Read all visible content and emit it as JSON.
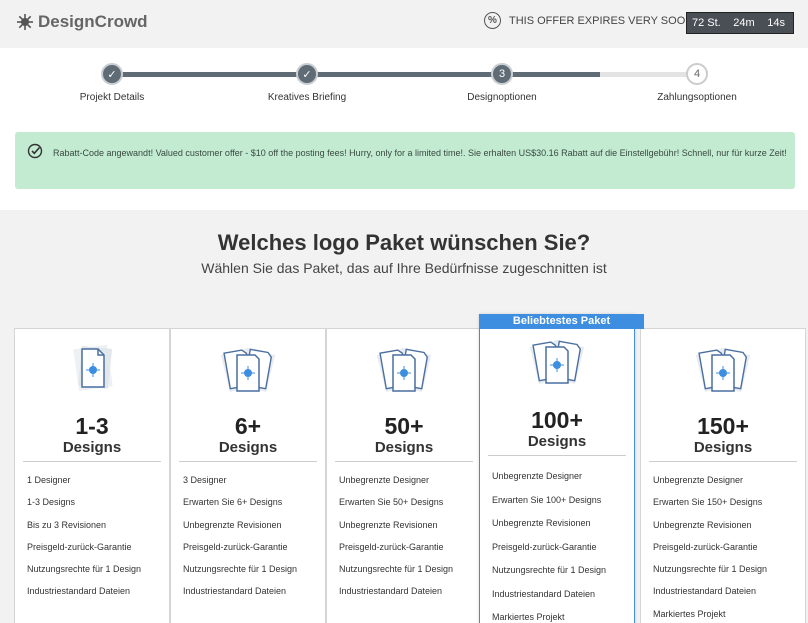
{
  "header": {
    "logo_text": "DesignCrowd",
    "offer_text": "THIS OFFER EXPIRES VERY SOON",
    "timer": {
      "hours": "72 St.",
      "minutes": "24m",
      "seconds": "14s"
    }
  },
  "steps": [
    {
      "label": "Projekt Details",
      "state": "done",
      "marker": "✓"
    },
    {
      "label": "Kreatives Briefing",
      "state": "done",
      "marker": "✓"
    },
    {
      "label": "Designoptionen",
      "state": "current",
      "marker": "3"
    },
    {
      "label": "Zahlungsoptionen",
      "state": "pending",
      "marker": "4"
    }
  ],
  "banner": {
    "text": "Rabatt-Code angewandt! Valued customer offer - $10 off the posting fees! Hurry, only for a limited time!. Sie erhalten US$30.16 Rabatt auf die Einstellgebühr! Schnell, nur für kurze Zeit!",
    "color": "#c2ebd2"
  },
  "main": {
    "title": "Welches logo Paket wünschen Sie?",
    "subtitle": "Wählen Sie das Paket, das auf Ihre Bedürfnisse zugeschnitten ist"
  },
  "packages": [
    {
      "number": "1-3",
      "word": "Designs",
      "icon": "single-design-icon",
      "features": [
        "1 Designer",
        "1-3 Designs",
        "Bis zu 3 Revisionen",
        "Preisgeld-zurück-Garantie",
        "Nutzungsrechte für 1 Design",
        "Industriestandard Dateien"
      ]
    },
    {
      "number": "6+",
      "word": "Designs",
      "icon": "multi-design-icon",
      "features": [
        "3 Designer",
        "Erwarten Sie 6+ Designs",
        "Unbegrenzte Revisionen",
        "Preisgeld-zurück-Garantie",
        "Nutzungsrechte für 1 Design",
        "Industriestandard Dateien"
      ]
    },
    {
      "number": "50+",
      "word": "Designs",
      "icon": "multi-design-icon",
      "features": [
        "Unbegrenzte Designer",
        "Erwarten Sie 50+ Designs",
        "Unbegrenzte Revisionen",
        "Preisgeld-zurück-Garantie",
        "Nutzungsrechte für 1 Design",
        "Industriestandard Dateien"
      ]
    },
    {
      "number": "100+",
      "word": "Designs",
      "icon": "multi-design-icon",
      "ribbon": "Beliebtestes Paket",
      "features": [
        "Unbegrenzte Designer",
        "Erwarten Sie 100+ Designs",
        "Unbegrenzte Revisionen",
        "Preisgeld-zurück-Garantie",
        "Nutzungsrechte für 1 Design",
        "Industriestandard Dateien",
        "Markiertes Projekt"
      ]
    },
    {
      "number": "150+",
      "word": "Designs",
      "icon": "multi-design-icon",
      "features": [
        "Unbegrenzte Designer",
        "Erwarten Sie 150+ Designs",
        "Unbegrenzte Revisionen",
        "Preisgeld-zurück-Garantie",
        "Nutzungsrechte für 1 Design",
        "Industriestandard Dateien",
        "Markiertes Projekt"
      ]
    }
  ],
  "colors": {
    "accent": "#3d8ee0",
    "progress": "#5f6b75",
    "timer_bg": "#4a4f55"
  }
}
